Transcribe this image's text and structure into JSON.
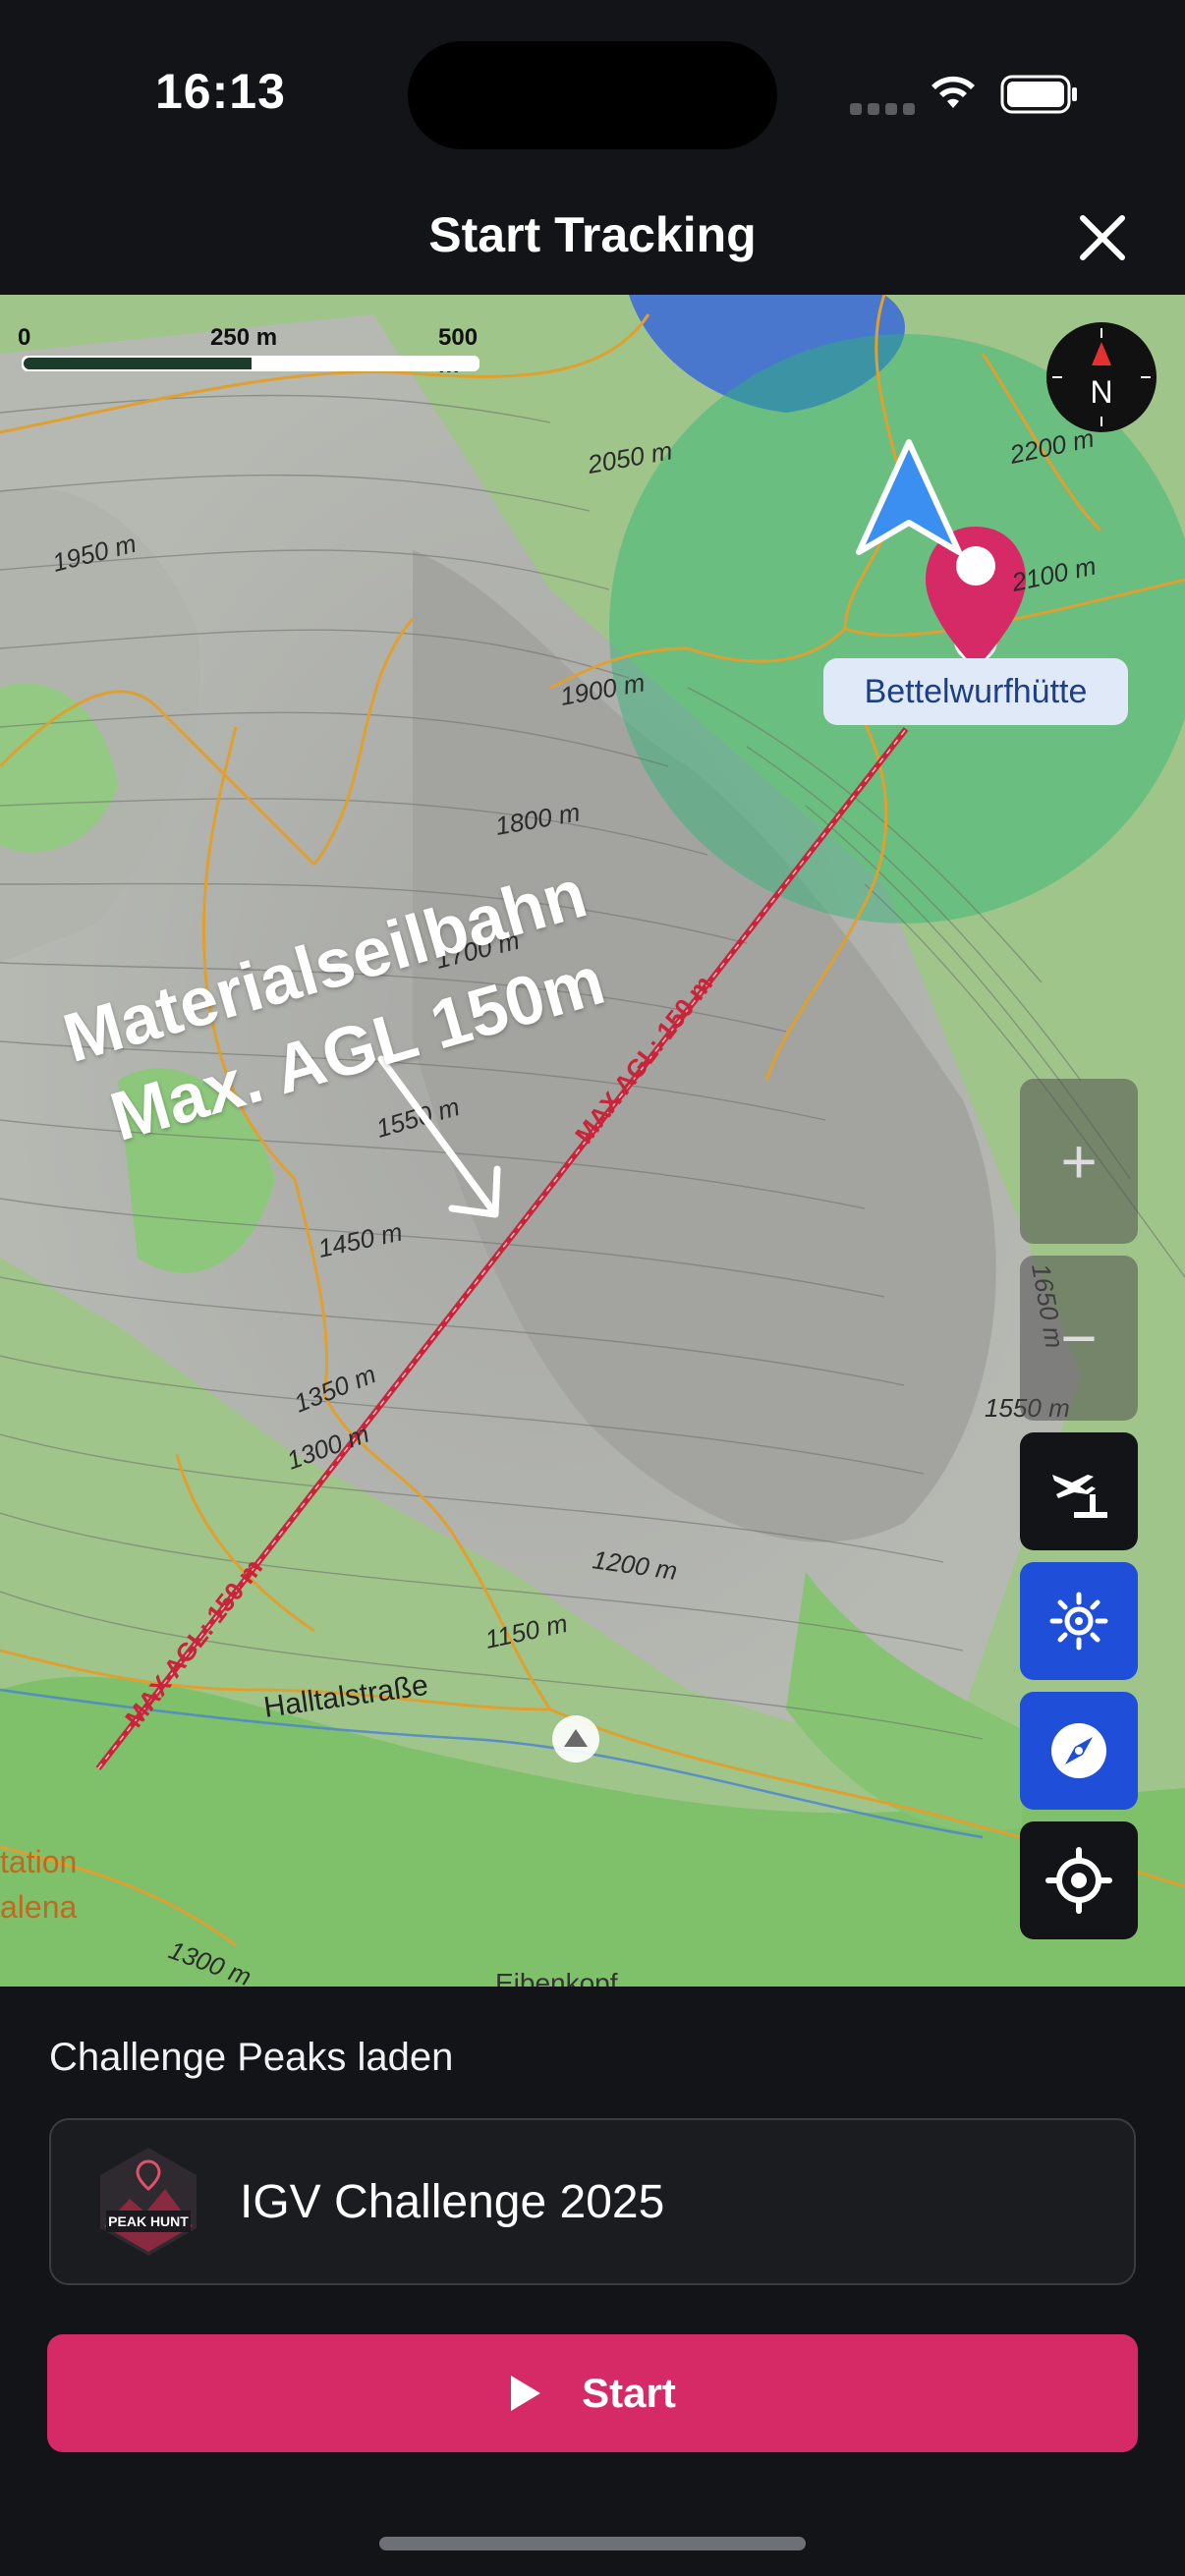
{
  "status_bar": {
    "time": "16:13",
    "icons": [
      "signal-icon",
      "wifi-icon",
      "battery-icon"
    ]
  },
  "header": {
    "title": "Start Tracking",
    "close_icon": "close-icon"
  },
  "map": {
    "scale": {
      "labels": [
        "0",
        "250 m",
        "500 m"
      ]
    },
    "compass_letter": "N",
    "hut_label": "Bettelwurfhütte",
    "annotation": {
      "line1": "Materialseilbahn",
      "line2": "Max. AGL 150m"
    },
    "cable_labels": [
      "MAX AGL: 150 m",
      "MAX AGL: 150 m"
    ],
    "contours": [
      "2050 m",
      "1950 m",
      "2200 m",
      "2100 m",
      "1900 m",
      "1800 m",
      "1700 m",
      "1550 m",
      "1450 m",
      "1350 m",
      "1300 m",
      "1200 m",
      "1150 m",
      "1650 m",
      "1550 m",
      "1300 m"
    ],
    "road_label": "Halltalstraße",
    "place_labels": [
      "tation",
      "alena",
      "Eibenkopf"
    ],
    "controls": {
      "zoom_in": "+",
      "zoom_out": "−",
      "icons": [
        "airspace-icon",
        "brightness-icon",
        "compass-nav-icon",
        "locate-icon"
      ]
    },
    "colors": {
      "water": "#3a68d8",
      "coverage": "#2bb673",
      "route": "#d62a66",
      "cable": "#c8253a"
    }
  },
  "challenge": {
    "section_label": "Challenge Peaks laden",
    "name": "IGV Challenge 2025",
    "logo_text": "PEAK HUNT"
  },
  "start_button": {
    "label": "Start",
    "icon": "play-icon",
    "color": "#d62a66"
  }
}
